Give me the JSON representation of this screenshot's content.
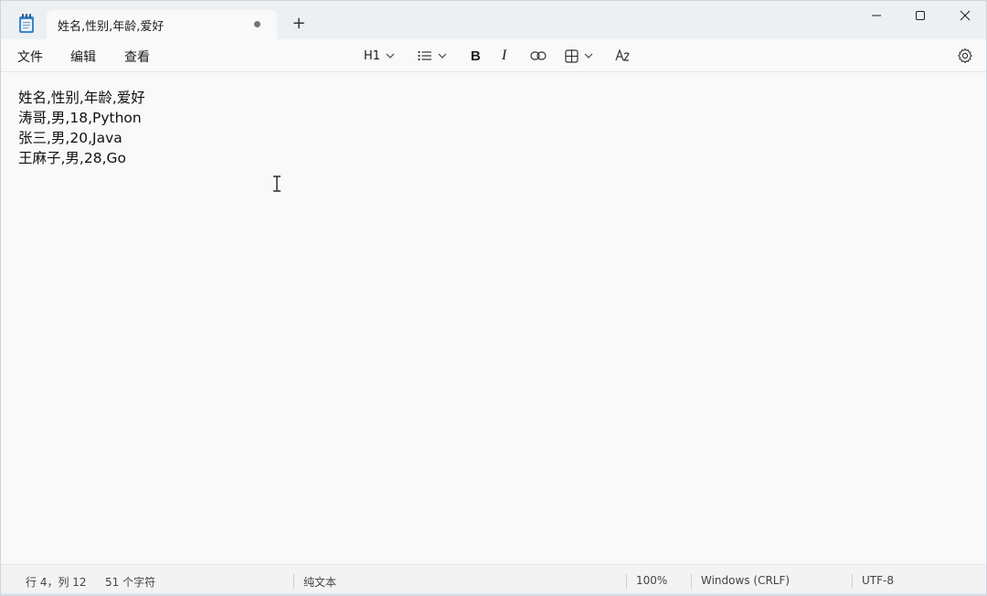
{
  "window": {
    "tab_title": "姓名,性别,年龄,爱好",
    "new_tab": "+",
    "unsaved_indicator": "modified-dot"
  },
  "menu": {
    "file": "文件",
    "edit": "编辑",
    "view": "查看"
  },
  "toolbar": {
    "heading": "H1",
    "icons": [
      "list-icon",
      "bold-icon",
      "italic-icon",
      "link-icon",
      "table-icon",
      "clear-format-icon"
    ],
    "bold_label": "B",
    "italic_label": "I"
  },
  "editor": {
    "lines": [
      "姓名,性别,年龄,爱好",
      "涛哥,男,18,Python",
      "张三,男,20,Java",
      "王麻子,男,28,Go"
    ]
  },
  "status": {
    "position": "行 4，列 12",
    "char_count": "51 个字符",
    "format": "纯文本",
    "zoom": "100%",
    "line_ending": "Windows (CRLF)",
    "encoding": "UTF-8"
  },
  "colors": {
    "titlebar_bg": "#edf0f3",
    "editor_bg": "#f9f9f9",
    "status_bg": "#f3f3f3"
  }
}
